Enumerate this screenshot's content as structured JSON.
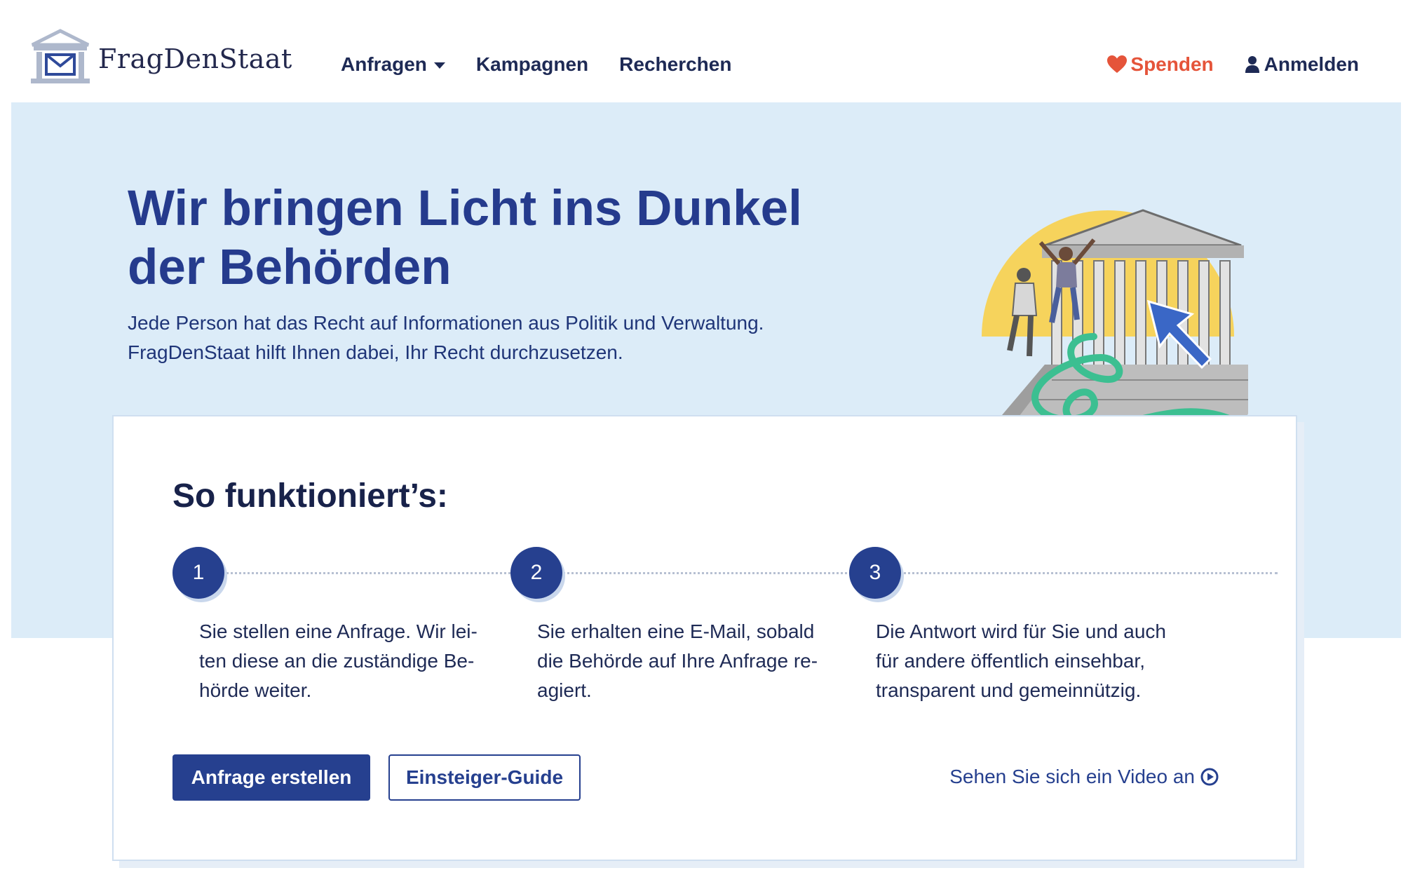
{
  "header": {
    "logo_text": "FragDenStaat",
    "nav": [
      {
        "label": "Anfragen",
        "has_dropdown": true
      },
      {
        "label": "Kampagnen"
      },
      {
        "label": "Recherchen"
      }
    ],
    "donate_label": "Spenden",
    "login_label": "Anmelden"
  },
  "hero": {
    "title_line1": "Wir bringen Licht ins Dunkel",
    "title_line2": "der Behörden",
    "subtitle_line1": "Jede Person hat das Recht auf Informationen aus Politik und Verwaltung.",
    "subtitle_line2": "FragDenStaat hilft Ihnen dabei, Ihr Recht durchzusetzen."
  },
  "how_it_works": {
    "title": "So funktioniert’s:",
    "steps": [
      {
        "number": "1",
        "lines": [
          "Sie stellen eine Anfrage. Wir lei-",
          "ten diese an die zuständige Be-",
          "hörde weiter."
        ]
      },
      {
        "number": "2",
        "lines": [
          "Sie erhalten eine E-Mail, sobald",
          "die Behörde auf Ihre Anfrage re-",
          "agiert."
        ]
      },
      {
        "number": "3",
        "lines": [
          "Die Antwort wird für Sie und auch",
          "für andere öffentlich einsehbar,",
          "transparent und gemeinnützig."
        ]
      }
    ],
    "primary_button": "Anfrage erstellen",
    "secondary_button": "Einsteiger-Guide",
    "video_link": "Sehen Sie sich ein Video an"
  },
  "colors": {
    "brand_blue": "#26408f",
    "hero_bg": "#dcecf8",
    "donate_red": "#e5543a",
    "accent_yellow": "#f6d35c",
    "accent_green": "#3cbf91"
  },
  "icons": [
    "logo-building-icon",
    "chevron-down-icon",
    "heart-icon",
    "user-icon",
    "play-circle-icon"
  ]
}
